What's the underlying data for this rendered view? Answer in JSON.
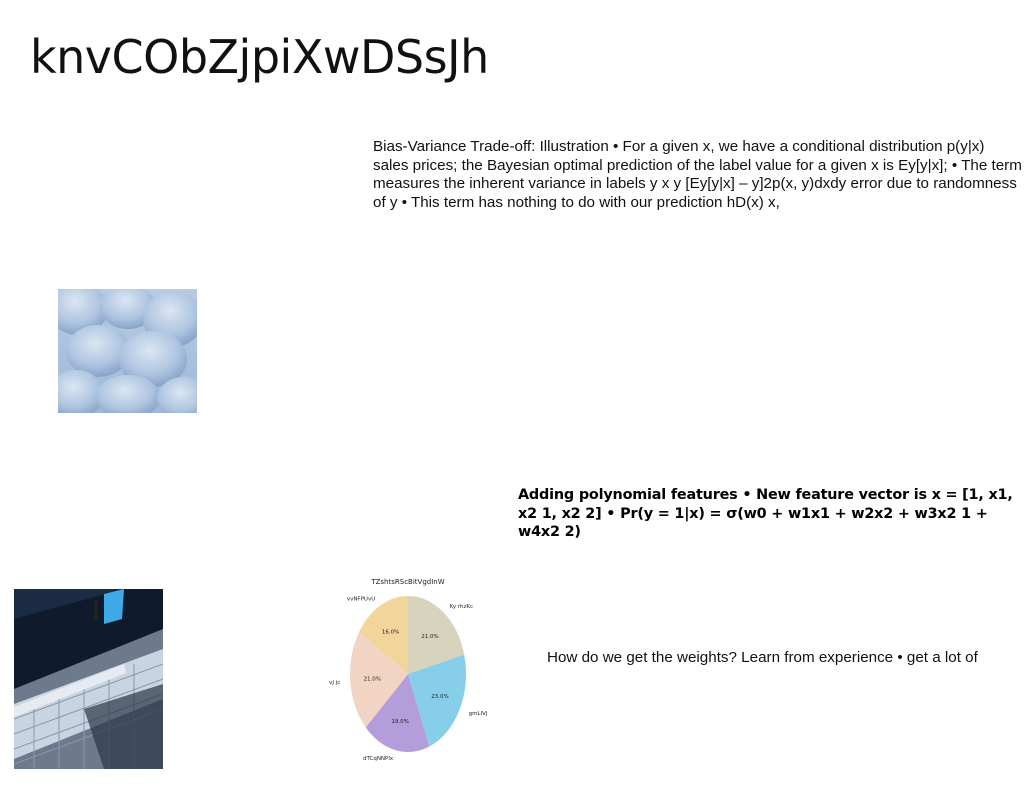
{
  "page": {
    "title": "knvCObZjpiXwDSsJh"
  },
  "blocks": {
    "bias_variance": "Bias-Variance Trade-off: Illustration • For a given x, we have a conditional distribution p(y|x) sales prices; the Bayesian optimal prediction of the label value for a given x is Ey[y|x]; • The term measures the inherent variance in labels y  x  y [Ey[y|x] – y]2p(x, y)dxdy    error due to randomness of y • This term has nothing to do with our prediction hD(x) x,",
    "polynomial": "Adding polynomial features • New feature vector is x = [1, x1, x2 1, x2 2] • Pr(y = 1|x) = σ(w0 + w1x1 + w2x2 + w3x2 1 + w4x2 2)",
    "weights": "How do we get the weights? Learn from experience • get a lot of"
  },
  "images": {
    "snow": "snow-terrain-image",
    "stairs": "stairs-shadow-image"
  },
  "chart_data": {
    "type": "pie",
    "title": "TZshtsRScBitVgdInW",
    "series": [
      {
        "name": "Ky rhzKc",
        "value": 21.0,
        "label": "21.0%",
        "color": "#d8d3bd"
      },
      {
        "name": "gmLIVj",
        "value": 23.0,
        "label": "23.0%",
        "color": "#87ceeb"
      },
      {
        "name": "dTCqNNPlx",
        "value": 19.0,
        "label": "19.0%",
        "color": "#b39ddb"
      },
      {
        "name": "vJ jc",
        "value": 21.0,
        "label": "21.0%",
        "color": "#f2d4c5"
      },
      {
        "name": "vvNFPUvU",
        "value": 16.0,
        "label": "16.0%",
        "color": "#f2d59b"
      }
    ]
  }
}
